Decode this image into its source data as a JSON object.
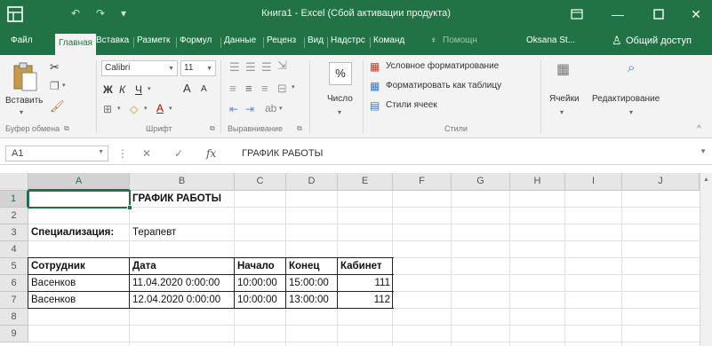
{
  "titlebar": {
    "title": "Книга1 - Excel (Сбой активации продукта)",
    "bg": "#217346"
  },
  "tabs": [
    {
      "label": "Файл"
    },
    {
      "label": "Главная"
    },
    {
      "label": "Вставка"
    },
    {
      "label": "Разметк"
    },
    {
      "label": "Формул"
    },
    {
      "label": "Данные"
    },
    {
      "label": "Реценз"
    },
    {
      "label": "Вид"
    },
    {
      "label": "Надстрс"
    },
    {
      "label": "Команд"
    }
  ],
  "tell_me": "Помощн",
  "user": "Oksana St...",
  "share": "Общий доступ",
  "ribbon": {
    "paste": "Вставить",
    "clipboard": "Буфер обмена",
    "font_name": "Calibri",
    "font_size": "11",
    "font_group": "Шрифт",
    "align_group": "Выравнивание",
    "number_label": "Число",
    "cond_format": "Условное форматирование",
    "format_table": "Форматировать как таблицу",
    "cell_styles": "Стили ячеек",
    "styles_group": "Стили",
    "cells": "Ячейки",
    "editing": "Редактирование",
    "bold": "Ж",
    "italic": "К",
    "underline": "Ч",
    "grow": "A",
    "shrink": "A",
    "pct": "%"
  },
  "formula_bar": {
    "name_box": "A1",
    "fx": "fx",
    "content": "ГРАФИК РАБОТЫ"
  },
  "sheet": {
    "columns": [
      "A",
      "B",
      "C",
      "D",
      "E",
      "F",
      "G",
      "H",
      "I",
      "J"
    ],
    "rows": [
      "1",
      "2",
      "3",
      "4",
      "5",
      "6",
      "7",
      "8",
      "9"
    ],
    "title": "ГРАФИК РАБОТЫ",
    "spec_label": "Специализация:",
    "spec_value": "Терапевт",
    "headers": [
      "Сотрудник",
      "Дата",
      "Начало",
      "Конец",
      "Кабинет"
    ],
    "data_rows": [
      [
        "Васенков",
        "11.04.2020 0:00:00",
        "10:00:00",
        "15:00:00",
        "111"
      ],
      [
        "Васенков",
        "12.04.2020 0:00:00",
        "10:00:00",
        "13:00:00",
        "112"
      ]
    ]
  }
}
